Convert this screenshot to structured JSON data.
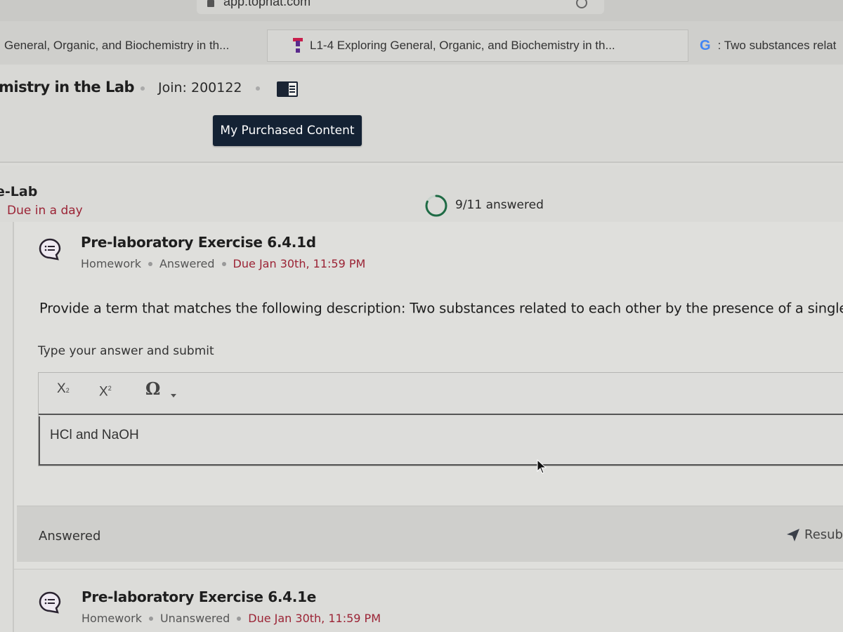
{
  "browser": {
    "url": "app.tophat.com",
    "tabs": [
      {
        "label": "General, Organic, and Biochemistry in th...",
        "icon": "none",
        "active": false
      },
      {
        "label": "L1-4 Exploring General, Organic, and Biochemistry in th...",
        "icon": "tophat-icon",
        "active": true
      },
      {
        "label": ": Two substances relat",
        "icon": "google-icon",
        "active": false
      }
    ]
  },
  "course": {
    "title": "mistry in the Lab",
    "join_code": "Join: 200122",
    "purchased_button": "My Purchased Content"
  },
  "section": {
    "title": "e-Lab",
    "due": "Due in a day",
    "progress": {
      "answered": 9,
      "total": 11,
      "label": "9/11 answered"
    }
  },
  "items": [
    {
      "title": "Pre-laboratory Exercise 6.4.1d",
      "type": "Homework",
      "status": "Answered",
      "due": "Due Jan 30th, 11:59 PM",
      "question": "Provide a term that matches the following description: Two substances related to each other by the presence of a single H",
      "question_sup": "+",
      "question_end": ".",
      "instructions": "Type your answer and submit",
      "toolbar": {
        "subscript": "X",
        "subscript_small": "2",
        "superscript": "X",
        "superscript_small": "2",
        "special_chars": "Ω"
      },
      "answer_value": "HCl and NaOH",
      "answer_status": "Answered",
      "resubmit_label": "Resub"
    },
    {
      "title": "Pre-laboratory Exercise 6.4.1e",
      "type": "Homework",
      "status": "Unanswered",
      "due": "Due Jan 30th, 11:59 PM"
    }
  ],
  "colors": {
    "due_red": "#9b2335",
    "button_navy": "#142234",
    "progress_green": "#1f6b45"
  }
}
